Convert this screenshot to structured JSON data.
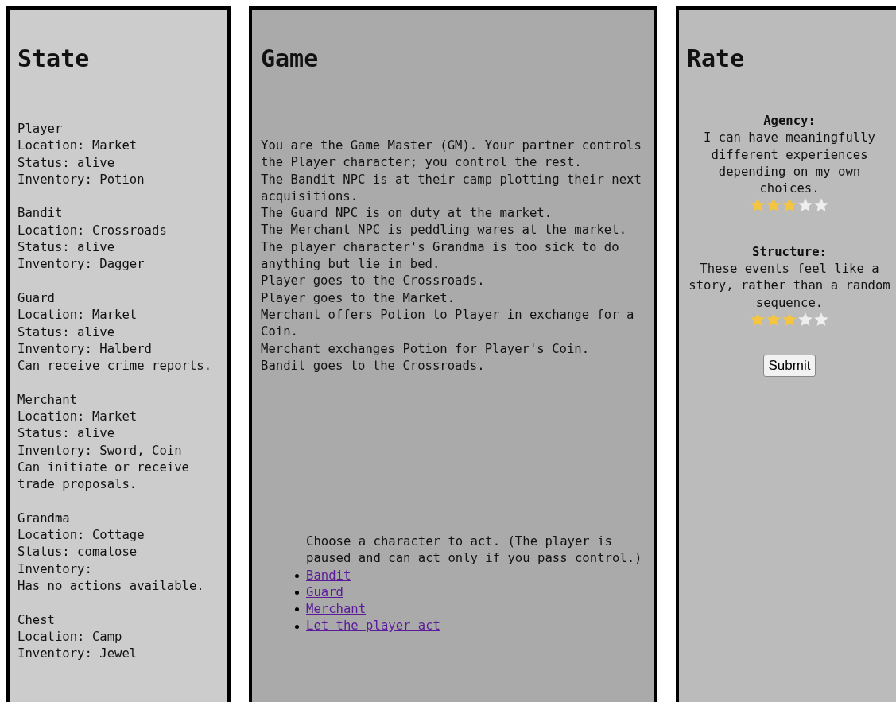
{
  "state": {
    "title": "State",
    "entities": [
      {
        "lines": [
          "Player",
          "Location: Market",
          "Status: alive",
          "Inventory: Potion"
        ]
      },
      {
        "lines": [
          "Bandit",
          "Location: Crossroads",
          "Status: alive",
          "Inventory: Dagger"
        ]
      },
      {
        "lines": [
          "Guard",
          "Location: Market",
          "Status: alive",
          "Inventory: Halberd",
          "Can receive crime reports."
        ]
      },
      {
        "lines": [
          "Merchant",
          "Location: Market",
          "Status: alive",
          "Inventory: Sword, Coin",
          "Can initiate or receive trade proposals."
        ]
      },
      {
        "lines": [
          "Grandma",
          "Location: Cottage",
          "Status: comatose",
          "Inventory:",
          "Has no actions available."
        ]
      },
      {
        "lines": [
          "Chest",
          "Location: Camp",
          "Inventory: Jewel"
        ]
      }
    ]
  },
  "game": {
    "title": "Game",
    "log": [
      "You are the Game Master (GM). Your partner controls the Player character; you control the rest.",
      "The Bandit NPC is at their camp plotting their next acquisitions.",
      "The Guard NPC is on duty at the market.",
      "The Merchant NPC is peddling wares at the market.",
      "The player character's Grandma is too sick to do anything but lie in bed.",
      "Player goes to the Crossroads.",
      "Player goes to the Market.",
      "Merchant offers Potion to Player in exchange for a Coin.",
      "Merchant exchanges Potion for Player's Coin.",
      "Bandit goes to the Crossroads."
    ],
    "prompt": "Choose a character to act. (The player is paused and can act only if you pass control.)",
    "choices": [
      "Bandit",
      "Guard",
      "Merchant",
      "Let the player act"
    ]
  },
  "rate": {
    "title": "Rate",
    "questions": [
      {
        "label": "Agency:",
        "text": "I can have meaningfully different experiences depending on my own choices.",
        "stars": 3
      },
      {
        "label": "Structure:",
        "text": "These events feel like a story, rather than a random sequence.",
        "stars": 3
      }
    ],
    "submit": "Submit"
  }
}
